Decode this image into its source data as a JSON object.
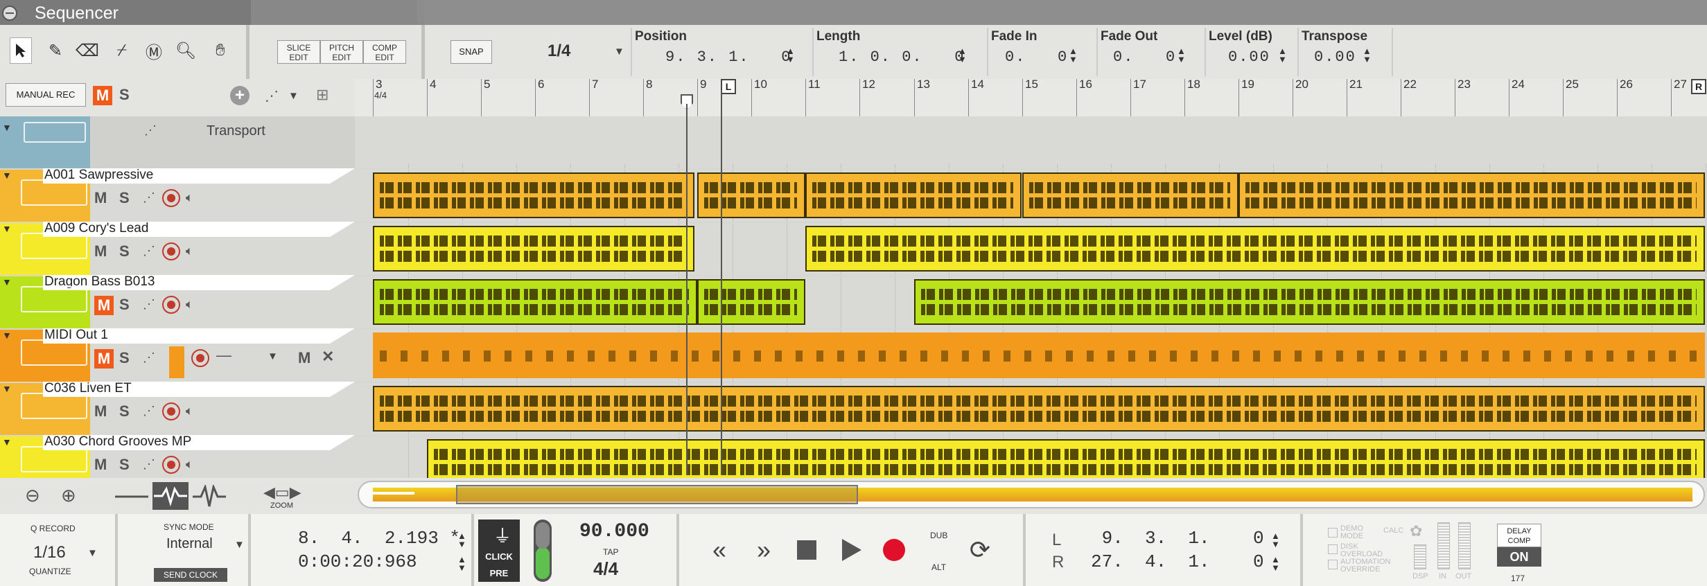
{
  "window": {
    "title": "Sequencer"
  },
  "toolbar": {
    "slice_edit": "SLICE EDIT",
    "pitch_edit": "PITCH EDIT",
    "comp_edit": "COMP EDIT",
    "snap": "SNAP",
    "grid": "1/4",
    "fields": [
      {
        "label": "Position",
        "value": "9. 3. 1.   0"
      },
      {
        "label": "Length",
        "value": "1. 0. 0.   0"
      },
      {
        "label": "Fade In",
        "value": "0.   0"
      },
      {
        "label": "Fade Out",
        "value": "0.   0"
      },
      {
        "label": "Level (dB)",
        "value": "0.00"
      },
      {
        "label": "Transpose",
        "value": "0.00"
      }
    ]
  },
  "header": {
    "manual_rec": "MANUAL REC",
    "m": "M",
    "s": "S"
  },
  "ruler": {
    "bars": [
      "3",
      "4",
      "5",
      "6",
      "7",
      "8",
      "9",
      "10",
      "11",
      "12",
      "13",
      "14",
      "15",
      "16",
      "17",
      "18",
      "19",
      "20",
      "21",
      "22",
      "23",
      "24",
      "25",
      "26",
      "27"
    ],
    "signature": "4/4",
    "left_locator": "L",
    "right_locator": "R"
  },
  "tracks": [
    {
      "name": "Transport",
      "color": "#8ab4c4"
    },
    {
      "name": "A001 Sawpressive",
      "color": "#f5b731",
      "mute": "M",
      "solo": "S"
    },
    {
      "name": "A009 Cory's Lead",
      "color": "#f4ea2a",
      "mute": "M",
      "solo": "S"
    },
    {
      "name": "Dragon Bass B013",
      "color": "#b9e21a",
      "mute": "M",
      "solo": "S"
    },
    {
      "name": "MIDI Out 1",
      "color": "#f39a1c",
      "mute": "M",
      "solo": "S"
    },
    {
      "name": "C036 Liven ET",
      "color": "#f5b731",
      "mute": "M",
      "solo": "S"
    },
    {
      "name": "A030 Chord Grooves MP",
      "color": "#f4ea2a",
      "mute": "M",
      "solo": "S"
    }
  ],
  "zoom_label": "ZOOM",
  "transport": {
    "q_record": "Q RECORD",
    "quantize_value": "1/16",
    "quantize": "QUANTIZE",
    "sync_mode": "SYNC MODE",
    "sync_value": "Internal",
    "send_clock": "SEND CLOCK",
    "pos_bars": "8.  4.  2.193 *",
    "pos_time": "0:00:20:968",
    "click": "CLICK",
    "pre": "PRE",
    "tempo": "90.000",
    "tap": "TAP",
    "signature": "4/4",
    "dub": "DUB",
    "alt": "ALT",
    "loc_l_label": "L",
    "loc_r_label": "R",
    "loc_l": " 9.  3.  1.    0",
    "loc_r": "27.  4.  1.    0",
    "demo_mode": "DEMO MODE",
    "calc": "CALC",
    "disk_overload": "DISK OVERLOAD",
    "automation_override": "AUTOMATION OVERRIDE",
    "dsp": "DSP",
    "in": "IN",
    "out": "OUT",
    "delay_comp": "DELAY COMP",
    "delay_on": "ON",
    "delay_value": "177"
  }
}
